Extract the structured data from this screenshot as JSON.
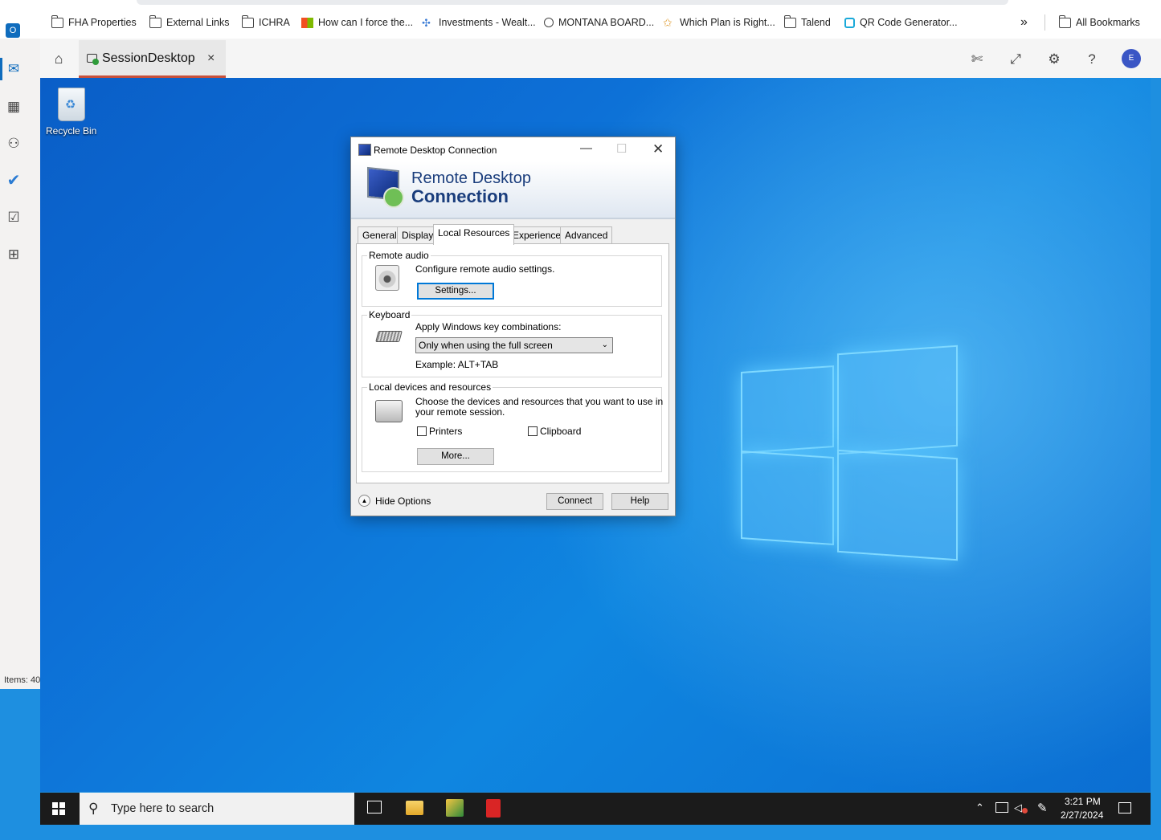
{
  "bookmarks": {
    "items": [
      {
        "label": "FHA Properties"
      },
      {
        "label": "External Links"
      },
      {
        "label": "ICHRA"
      },
      {
        "label": "How can I force the..."
      },
      {
        "label": "Investments - Wealt..."
      },
      {
        "label": "MONTANA BOARD..."
      },
      {
        "label": "Which Plan is Right..."
      },
      {
        "label": "Talend"
      },
      {
        "label": "QR Code Generator..."
      }
    ],
    "more": "»",
    "all_bookmarks": "All Bookmarks"
  },
  "outlook_rail": {
    "items_count": "Items: 40",
    "icons": [
      "outlook-icon",
      "mail-icon",
      "calendar-icon",
      "people-icon",
      "todo-icon",
      "tasks-icon",
      "apps-icon"
    ]
  },
  "session": {
    "tab_label": "SessionDesktop",
    "close_glyph": "×",
    "avatar_initial": "E",
    "help_glyph": "?"
  },
  "desktop": {
    "recycle_bin": "Recycle Bin"
  },
  "dialog": {
    "title": "Remote Desktop Connection",
    "banner_line1": "Remote Desktop",
    "banner_line2": "Connection",
    "tabs": [
      "General",
      "Display",
      "Local Resources",
      "Experience",
      "Advanced"
    ],
    "active_tab": "Local Resources",
    "remote_audio": {
      "label": "Remote audio",
      "description": "Configure remote audio settings.",
      "settings_button": "Settings..."
    },
    "keyboard": {
      "label": "Keyboard",
      "prompt": "Apply Windows key combinations:",
      "selected": "Only when using the full screen",
      "example": "Example: ALT+TAB"
    },
    "local_devices": {
      "label": "Local devices and resources",
      "description_line1": "Choose the devices and resources that you want to use in",
      "description_line2": "your remote session.",
      "printers": "Printers",
      "clipboard": "Clipboard",
      "printers_checked": false,
      "clipboard_checked": false,
      "more_button": "More..."
    },
    "hide_options": "Hide Options",
    "connect_button": "Connect",
    "help_button": "Help"
  },
  "taskbar": {
    "search_placeholder": "Type here to search",
    "time": "3:21 PM",
    "date": "2/27/2024"
  }
}
